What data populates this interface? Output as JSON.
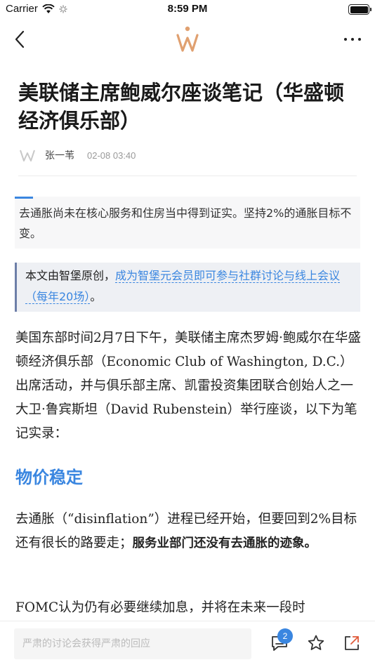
{
  "status_bar": {
    "carrier": "Carrier",
    "time": "8:59 PM"
  },
  "nav": {
    "logo_icon": "wisburg-logo-icon",
    "back_icon": "chevron-left-icon",
    "more_icon": "ellipsis-icon"
  },
  "article": {
    "title": "美联储主席鲍威尔座谈笔记（华盛顿经济俱乐部）",
    "author": "张一苇",
    "date": "02-08 03:40",
    "summary": "去通胀尚未在核心服务和住房当中得到证实。坚持2%的通胀目标不变。",
    "quote_prefix": "本文由智堡原创，",
    "quote_link": "成为智堡元会员即可参与社群讨论与线上会议（每年20场）",
    "quote_suffix": "。",
    "paragraph1": "美国东部时间2月7日下午，美联储主席杰罗姆·鲍威尔在华盛顿经济俱乐部（Economic Club of Washington, D.C.）出席活动，并与俱乐部主席、凯雷投资集团联合创始人之一大卫·鲁宾斯坦（David Rubenstein）举行座谈，以下为笔记实录：",
    "section_heading": "物价稳定",
    "paragraph2_normal": "去通胀（“disinflation”）进程已经开始，但要回到2%目标还有很长的路要走；",
    "paragraph2_bold": "服务业部门还没有去通胀的迹象。",
    "paragraph3": "FOMC认为仍有必要继续加息，并将在未来一段时"
  },
  "bottom_bar": {
    "comment_placeholder": "严肃的讨论会获得严肃的回应",
    "comment_count": "2",
    "comment_icon": "comment-icon",
    "star_icon": "star-icon",
    "share_icon": "share-icon"
  },
  "colors": {
    "accent": "#3a86e0",
    "logo": "#e0a070"
  }
}
